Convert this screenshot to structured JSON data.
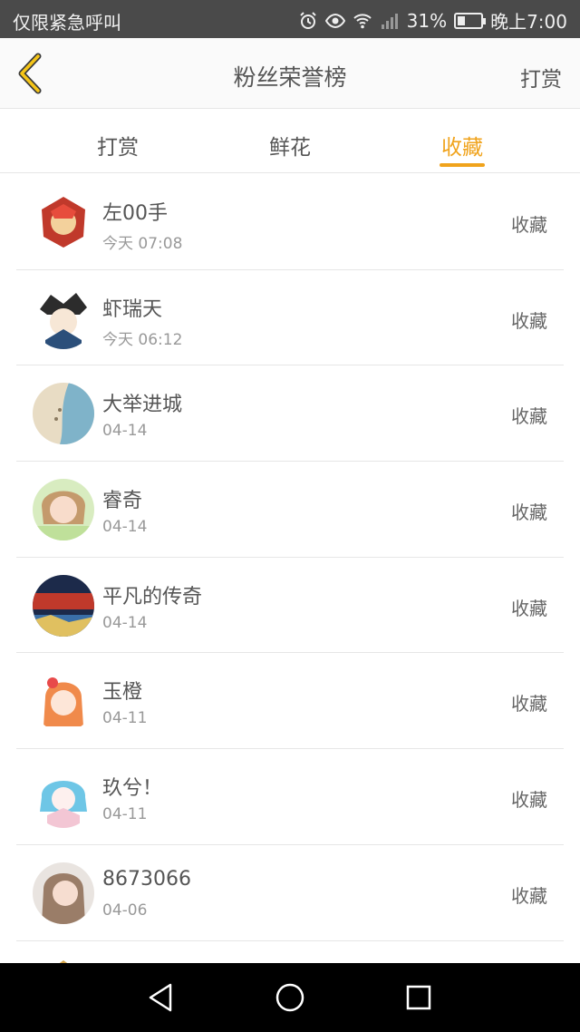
{
  "status_bar": {
    "left_text": "仅限紧急呼叫",
    "battery": "31%",
    "battery_level": 0.31,
    "time": "晚上7:00",
    "icons": [
      "alarm-icon",
      "eye-icon",
      "wifi-icon",
      "signal-icon",
      "battery-icon"
    ]
  },
  "header": {
    "title": "粉丝荣誉榜",
    "action": "打赏",
    "back_icon": "chevron-left-icon",
    "accent": "#f0a31c"
  },
  "tabs": [
    {
      "label": "打赏",
      "active": false
    },
    {
      "label": "鲜花",
      "active": false
    },
    {
      "label": "收藏",
      "active": true
    }
  ],
  "list": [
    {
      "name": "左00手",
      "time": "今天 07:08",
      "action": "收藏"
    },
    {
      "name": "虾瑞天",
      "time": "今天 06:12",
      "action": "收藏"
    },
    {
      "name": "大举进城",
      "time": "04-14",
      "action": "收藏"
    },
    {
      "name": "睿奇",
      "time": "04-14",
      "action": "收藏"
    },
    {
      "name": "平凡的传奇",
      "time": "04-14",
      "action": "收藏"
    },
    {
      "name": "玉橙",
      "time": "04-11",
      "action": "收藏"
    },
    {
      "name": "玖兮！",
      "time": "04-11",
      "action": "收藏"
    },
    {
      "name": "8673066",
      "time": "04-06",
      "action": "收藏"
    }
  ],
  "nav_bar": {
    "icons": [
      "back-triangle-icon",
      "home-circle-icon",
      "recents-square-icon"
    ]
  }
}
